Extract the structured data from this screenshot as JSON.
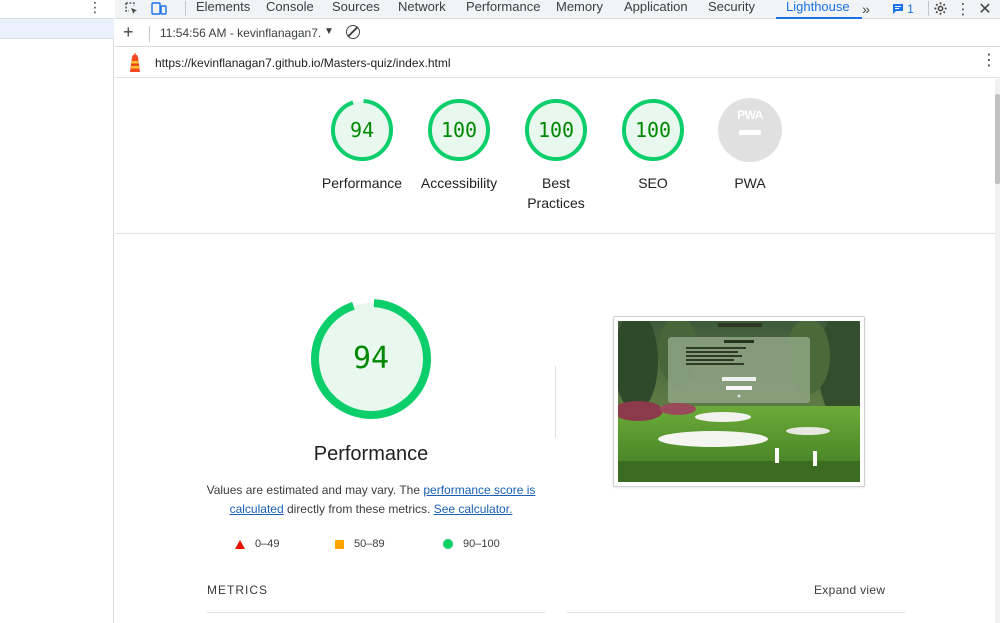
{
  "devtools": {
    "tabs": [
      {
        "label": "Elements"
      },
      {
        "label": "Console"
      },
      {
        "label": "Sources"
      },
      {
        "label": "Network"
      },
      {
        "label": "Performance"
      },
      {
        "label": "Memory"
      },
      {
        "label": "Application"
      },
      {
        "label": "Security"
      },
      {
        "label": "Lighthouse"
      }
    ],
    "active_tab": "Lighthouse",
    "issues_count": "1",
    "more_tabs_icon": "chevron-double-right-icon"
  },
  "toolbar": {
    "report_label": "11:54:56 AM - kevinflanagan7.",
    "new_report_icon": "plus-icon",
    "clear_icon": "clear-icon"
  },
  "urlbar": {
    "url": "https://kevinflanagan7.github.io/Masters-quiz/index.html"
  },
  "colors": {
    "pass": "#0cce6b",
    "pass_text": "#008800",
    "average": "#ffa400",
    "fail": "#eb0f00",
    "accent": "#1a73e8"
  },
  "summary": {
    "categories": [
      {
        "score": "94",
        "label": "Performance",
        "value": 94
      },
      {
        "score": "100",
        "label": "Accessibility",
        "value": 100
      },
      {
        "score": "100",
        "label": "Best Practices",
        "value": 100
      },
      {
        "score": "100",
        "label": "SEO",
        "value": 100
      },
      {
        "score": "",
        "label": "PWA",
        "badge_text": "PWA"
      }
    ]
  },
  "performance": {
    "score": "94",
    "value": 94,
    "title": "Performance",
    "desc_prefix": "Values are estimated and may vary. The ",
    "link_score": "performance score is calculated",
    "desc_middle": " directly from these metrics. ",
    "link_calc": "See calculator.",
    "legend": [
      {
        "range": "0–49",
        "shape": "triangle"
      },
      {
        "range": "50–89",
        "shape": "square"
      },
      {
        "range": "90–100",
        "shape": "circle"
      }
    ]
  },
  "metrics": {
    "title": "METRICS",
    "expand_label": "Expand view"
  }
}
